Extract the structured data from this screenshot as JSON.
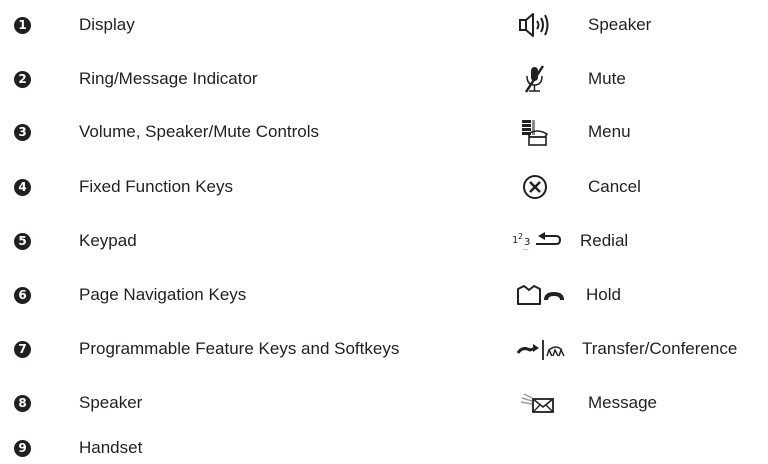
{
  "components": [
    {
      "number": "1",
      "label": "Display"
    },
    {
      "number": "2",
      "label": "Ring/Message Indicator"
    },
    {
      "number": "3",
      "label": "Volume, Speaker/Mute Controls"
    },
    {
      "number": "4",
      "label": "Fixed Function Keys"
    },
    {
      "number": "5",
      "label": "Keypad"
    },
    {
      "number": "6",
      "label": "Page Navigation Keys"
    },
    {
      "number": "7",
      "label": "Programmable Feature Keys and Softkeys"
    },
    {
      "number": "8",
      "label": "Speaker"
    },
    {
      "number": "9",
      "label": "Handset"
    }
  ],
  "keys": [
    {
      "icon": "speaker-icon",
      "label": "Speaker"
    },
    {
      "icon": "mute-icon",
      "label": "Mute"
    },
    {
      "icon": "menu-icon",
      "label": "Menu"
    },
    {
      "icon": "cancel-icon",
      "label": "Cancel"
    },
    {
      "icon": "redial-icon",
      "label": "Redial",
      "icon_text": "123"
    },
    {
      "icon": "hold-icon",
      "label": "Hold"
    },
    {
      "icon": "transfer-conference-icon",
      "label": "Transfer/Conference"
    },
    {
      "icon": "message-icon",
      "label": "Message"
    }
  ]
}
